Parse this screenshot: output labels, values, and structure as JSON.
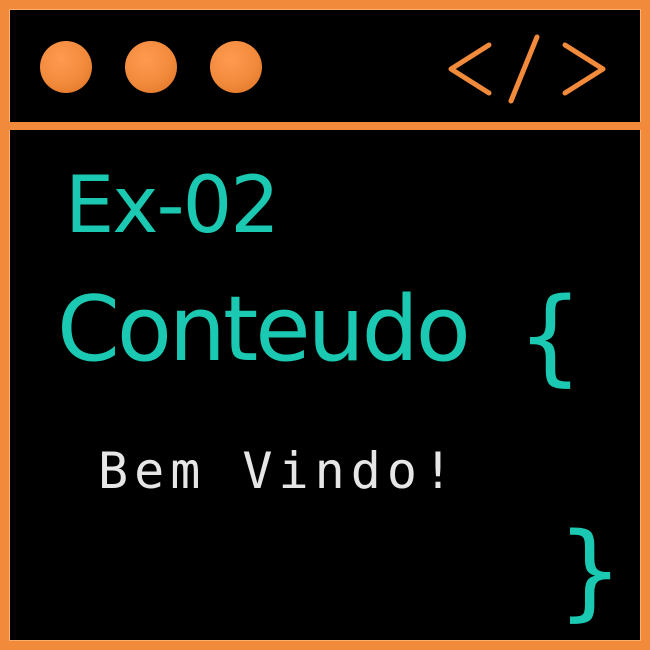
{
  "titlebar": {
    "dots": [
      "orange-dot",
      "orange-dot",
      "orange-dot"
    ],
    "icon": "code-tag-icon"
  },
  "content": {
    "title": "Ex-02",
    "heading": "Conteudo",
    "open_brace": "{",
    "greeting": "Bem Vindo!",
    "close_brace": "}"
  },
  "colors": {
    "accent": "#f28a3c",
    "teal": "#1bc8b1",
    "text": "#e6e6e6",
    "background": "#000000"
  }
}
